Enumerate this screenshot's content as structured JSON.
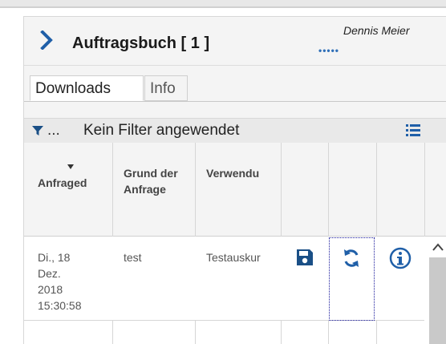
{
  "header": {
    "title": "Auftragsbuch [ 1 ]",
    "user_name": "Dennis Meier",
    "status_dots": "•••••"
  },
  "tabs": [
    {
      "label": "Downloads",
      "active": true
    },
    {
      "label": "Info",
      "active": false
    }
  ],
  "filter": {
    "ellipsis": "...",
    "text": "Kein Filter angewendet"
  },
  "table": {
    "columns": [
      {
        "label": "Anfraged"
      },
      {
        "label": "Grund der Anfrage"
      },
      {
        "label": "Verwendu"
      }
    ],
    "rows": [
      {
        "date_line1": "Di., 18",
        "date_line2": "Dez.",
        "date_line3": "2018",
        "date_line4": "15:30:58",
        "reason": "test",
        "usage": "Testauskur"
      }
    ]
  },
  "icons": {
    "chevron": "chevron-right-icon",
    "filter": "filter-icon",
    "list": "list-icon",
    "save": "save-icon",
    "refresh": "refresh-icon",
    "info": "info-icon",
    "scroll_up": "chevron-up-icon"
  },
  "colors": {
    "accent": "#1f5fa8",
    "icon_dark": "#1a4f86",
    "panel_bg": "#f4f4f4"
  }
}
